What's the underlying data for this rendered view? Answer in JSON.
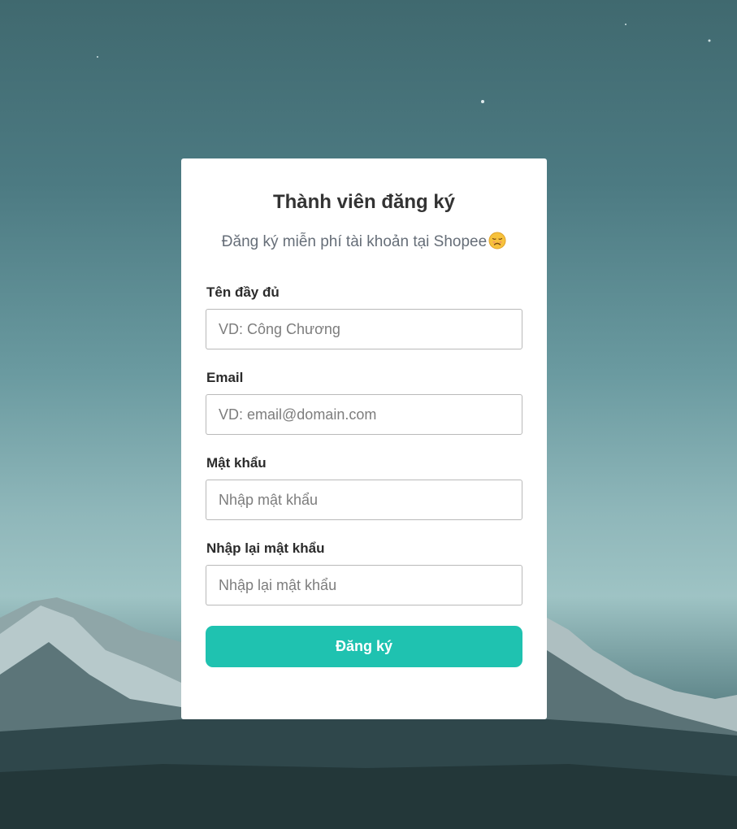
{
  "form": {
    "title": "Thành viên đăng ký",
    "subtitle": "Đăng ký miễn phí tài khoản tại Shopee",
    "subtitle_icon": "sad-face-emoji",
    "fields": [
      {
        "label": "Tên đầy đủ",
        "placeholder": "VD: Công Chương",
        "value": ""
      },
      {
        "label": "Email",
        "placeholder": "VD: email@domain.com",
        "value": ""
      },
      {
        "label": "Mật khẩu",
        "placeholder": "Nhập mật khẩu",
        "value": ""
      },
      {
        "label": "Nhập lại mật khẩu",
        "placeholder": "Nhập lại mật khẩu",
        "value": ""
      }
    ],
    "submit_label": "Đăng ký"
  },
  "colors": {
    "button": "#1fc2b0",
    "card": "#ffffff",
    "sky": "#4c7a82"
  }
}
